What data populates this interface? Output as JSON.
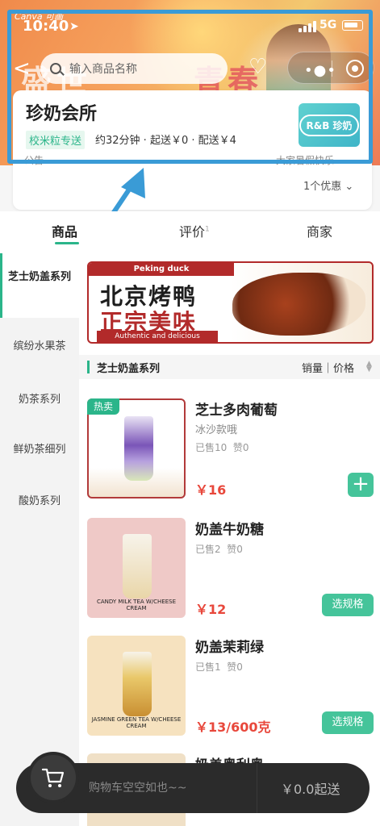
{
  "status": {
    "brand": "Canva 可画",
    "time": "10:40",
    "network": "5G"
  },
  "header": {
    "search_placeholder": "输入商品名称",
    "banner_text_left": "盛世",
    "banner_text_right": "青春"
  },
  "store": {
    "name": "珍奶会所",
    "logo_text": "R&B 珍奶",
    "delivery_tag": "校米粒专送",
    "delivery_info": "约32分钟 · 起送￥0 · 配送￥4",
    "promo_left": "公告",
    "promo_right": "大家暑假快乐",
    "discount": "1个优惠"
  },
  "tabs": [
    {
      "label": "商品",
      "badge": ""
    },
    {
      "label": "评价",
      "badge": "1"
    },
    {
      "label": "商家",
      "badge": ""
    }
  ],
  "categories": [
    {
      "label": "芝士奶盖系列"
    },
    {
      "label": "缤纷水果茶"
    },
    {
      "label": "奶茶系列"
    },
    {
      "label": "鲜奶茶细列"
    },
    {
      "label": "酸奶系列"
    }
  ],
  "ad": {
    "top": "Peking duck",
    "line1": "北京烤鸭",
    "line2": "正宗美味",
    "bottom": "Authentic and delicious"
  },
  "section": {
    "title": "芝士奶盖系列",
    "sort": "销量｜价格"
  },
  "products": [
    {
      "name": "芝士多肉葡萄",
      "desc": "冰沙款哦",
      "sold": "已售10",
      "likes": "赞0",
      "price": "￥16",
      "unit": "",
      "badge": "热卖",
      "action": "+"
    },
    {
      "name": "奶盖牛奶糖",
      "desc": "",
      "sold": "已售2",
      "likes": "赞0",
      "price": "￥12",
      "unit": "",
      "badge": "",
      "action": "选规格",
      "thumb_caption": "CANDY MILK TEA W/CHEESE CREAM"
    },
    {
      "name": "奶盖茉莉绿",
      "desc": "",
      "sold": "已售1",
      "likes": "赞0",
      "price": "￥13",
      "unit": "/600克",
      "badge": "",
      "action": "选规格",
      "thumb_caption": "JASMINE GREEN TEA W/CHEESE CREAM"
    },
    {
      "name": "奶盖奥利奥",
      "desc": "",
      "sold": "",
      "likes": "",
      "price": "",
      "unit": "",
      "badge": "",
      "action": ""
    }
  ],
  "cart": {
    "empty_text": "购物车空空如也~~",
    "checkout": "￥0.0起送"
  },
  "colors": {
    "accent": "#2bb58a",
    "price": "#e8473b",
    "highlight": "#3a9bd6"
  }
}
